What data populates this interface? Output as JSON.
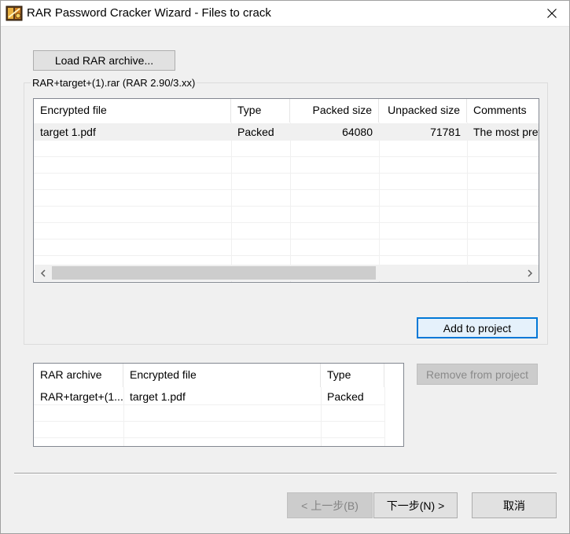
{
  "window": {
    "title": "RAR Password Cracker Wizard - Files to crack",
    "icon": "rar-cracker-app-icon",
    "close_icon": "close-icon"
  },
  "load_button": {
    "label": "Load RAR archive..."
  },
  "archive_group": {
    "label": "RAR+target+(1).rar (RAR 2.90/3.xx)"
  },
  "files_list": {
    "columns": [
      "Encrypted file",
      "Type",
      "Packed size",
      "Unpacked size",
      "Comments"
    ],
    "rows": [
      {
        "file": "target 1.pdf",
        "type": "Packed",
        "packed": "64080",
        "unpacked": "71781",
        "comments": "The most pref"
      }
    ]
  },
  "add_button": {
    "label": "Add to project"
  },
  "project_list": {
    "columns": [
      "RAR archive",
      "Encrypted file",
      "Type"
    ],
    "rows": [
      {
        "archive": "RAR+target+(1...",
        "file": "target 1.pdf",
        "type": "Packed"
      }
    ]
  },
  "remove_button": {
    "label": "Remove from project"
  },
  "footer": {
    "back_label": "< 上一步(B)",
    "next_label": "下一步(N) >",
    "cancel_label": "取消"
  }
}
